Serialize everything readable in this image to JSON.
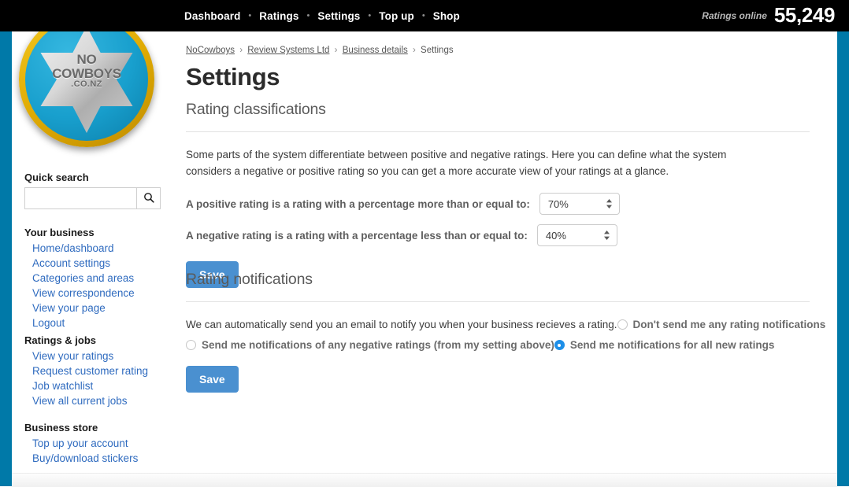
{
  "header": {
    "nav_items": [
      {
        "label": "Dashboard"
      },
      {
        "label": "Ratings"
      },
      {
        "label": "Settings"
      },
      {
        "label": "Top up"
      },
      {
        "label": "Shop"
      }
    ],
    "separator": "•",
    "ratings_online_label": "Ratings online",
    "ratings_online_count": "55,249",
    "accent_black": "#000000"
  },
  "logo": {
    "line1": "NO",
    "line2": "COWBOYS",
    "line3": ".CO.NZ",
    "ring_color": "#e0ab04",
    "disc_color": "#189fcd",
    "star_color": "#d8d8d8"
  },
  "sidebar": {
    "quick_search": {
      "title": "Quick search",
      "value": "",
      "placeholder": "",
      "search_icon": "search-icon"
    },
    "groups": [
      {
        "title": "Your business",
        "links": [
          "Home/dashboard",
          "Account settings",
          "Categories and areas",
          "View correspondence",
          "View your page",
          "Logout"
        ]
      },
      {
        "title": "Ratings & jobs",
        "links": [
          "View your ratings",
          "Request customer rating",
          "Job watchlist",
          "View all current jobs"
        ]
      },
      {
        "title": "Business store",
        "links": [
          "Top up your account",
          "Buy/download stickers"
        ]
      }
    ],
    "link_color": "#2f6bbf",
    "rail_color": "#0079a8"
  },
  "main": {
    "breadcrumb": [
      {
        "label": "NoCowboys",
        "link": true
      },
      {
        "label": "Review Systems Ltd",
        "link": true
      },
      {
        "label": "Business details",
        "link": true
      },
      {
        "label": "Settings",
        "link": false
      }
    ],
    "breadcrumb_separator": "›",
    "page_title": "Settings",
    "classifications": {
      "heading": "Rating classifications",
      "intro": "Some parts of the system differentiate between positive and negative ratings. Here you can define what the system considers a negative or positive rating so you can get a more accurate view of your ratings at a glance.",
      "positive_label": "A positive rating is a rating with a percentage more than or equal to:",
      "positive_value": "70%",
      "negative_label": "A negative rating is a rating with a percentage less than or equal to:",
      "negative_value": "40%",
      "save_label": "Save"
    },
    "notifications": {
      "heading": "Rating notifications",
      "intro": "We can automatically send you an email to notify you when your business recieves a rating.",
      "options": [
        {
          "label": "Don't send me any rating notifications",
          "selected": false
        },
        {
          "label": "Send me notifications of any negative ratings (from my setting above)",
          "selected": false
        },
        {
          "label": "Send me notifications for all new ratings",
          "selected": true
        }
      ],
      "save_label": "Save",
      "accent_color": "#1e8fe8"
    }
  }
}
